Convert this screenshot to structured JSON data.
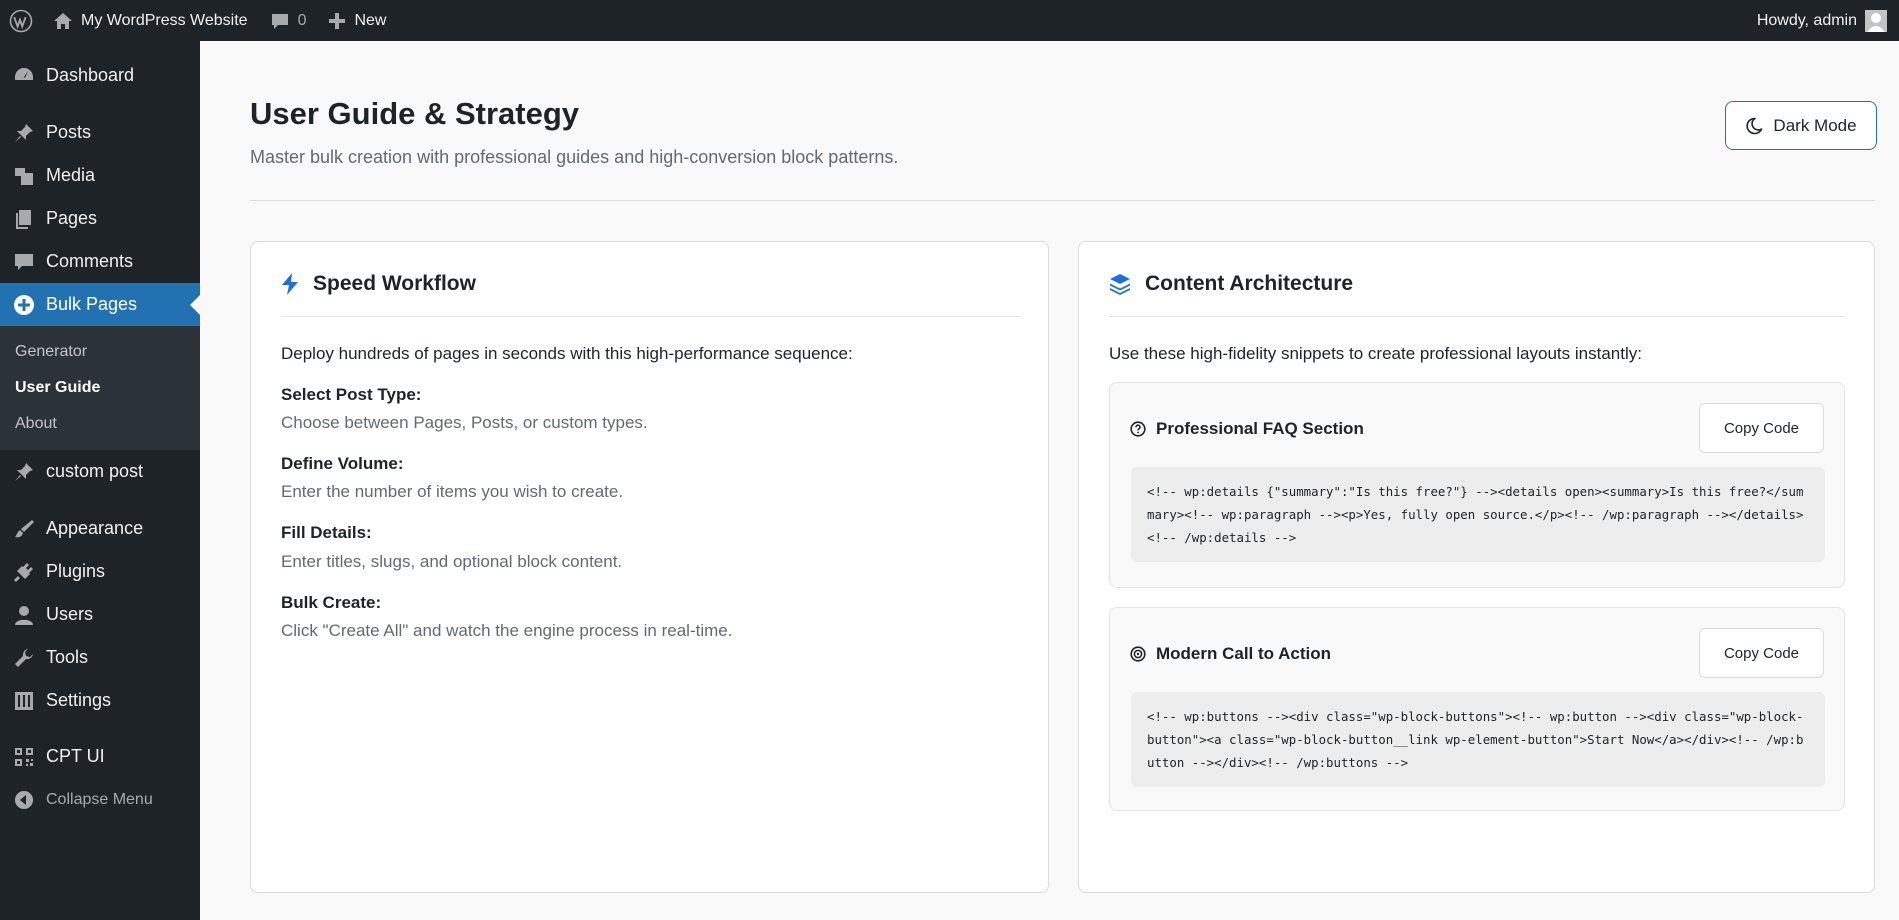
{
  "admin_bar": {
    "site_name": "My WordPress Website",
    "comments_count": "0",
    "new_label": "New",
    "greeting": "Howdy, admin"
  },
  "sidebar": {
    "items": [
      {
        "label": "Dashboard",
        "icon": "dashboard-icon"
      },
      {
        "label": "Posts",
        "icon": "pin-icon"
      },
      {
        "label": "Media",
        "icon": "media-icon"
      },
      {
        "label": "Pages",
        "icon": "pages-icon"
      },
      {
        "label": "Comments",
        "icon": "comment-icon"
      },
      {
        "label": "Bulk Pages",
        "icon": "plus-circle-icon"
      },
      {
        "label": "custom post",
        "icon": "pin-icon"
      },
      {
        "label": "Appearance",
        "icon": "brush-icon"
      },
      {
        "label": "Plugins",
        "icon": "plug-icon"
      },
      {
        "label": "Users",
        "icon": "user-icon"
      },
      {
        "label": "Tools",
        "icon": "wrench-icon"
      },
      {
        "label": "Settings",
        "icon": "sliders-icon"
      },
      {
        "label": "CPT UI",
        "icon": "qr-icon"
      }
    ],
    "submenu": [
      "Generator",
      "User Guide",
      "About"
    ],
    "collapse_label": "Collapse Menu"
  },
  "page": {
    "title": "User Guide & Strategy",
    "subtitle": "Master bulk creation with professional guides and high-conversion block patterns.",
    "dark_mode_label": "Dark Mode"
  },
  "speed_workflow": {
    "title": "Speed Workflow",
    "intro": "Deploy hundreds of pages in seconds with this high-performance sequence:",
    "steps": [
      {
        "title": "Select Post Type:",
        "desc": "Choose between Pages, Posts, or custom types."
      },
      {
        "title": "Define Volume:",
        "desc": "Enter the number of items you wish to create."
      },
      {
        "title": "Fill Details:",
        "desc": "Enter titles, slugs, and optional block content."
      },
      {
        "title": "Bulk Create:",
        "desc": "Click \"Create All\" and watch the engine process in real-time."
      }
    ]
  },
  "content_architecture": {
    "title": "Content Architecture",
    "intro": "Use these high-fidelity snippets to create professional layouts instantly:",
    "snippets": [
      {
        "title": "Professional FAQ Section",
        "copy_label": "Copy Code",
        "code": "<!-- wp:details {\"summary\":\"Is this free?\"} --><details open><summary>Is this free?</summary><!-- wp:paragraph --><p>Yes, fully open source.</p><!-- /wp:paragraph --></details><!-- /wp:details -->"
      },
      {
        "title": "Modern Call to Action",
        "copy_label": "Copy Code",
        "code": "<!-- wp:buttons --><div class=\"wp-block-buttons\"><!-- wp:button --><div class=\"wp-block-button\"><a class=\"wp-block-button__link wp-element-button\">Start Now</a></div><!-- /wp:button --></div><!-- /wp:buttons -->"
      }
    ]
  },
  "colors": {
    "admin_dark": "#1d2327",
    "accent": "#2271b1",
    "icon_blue": "#1e6fd9"
  }
}
